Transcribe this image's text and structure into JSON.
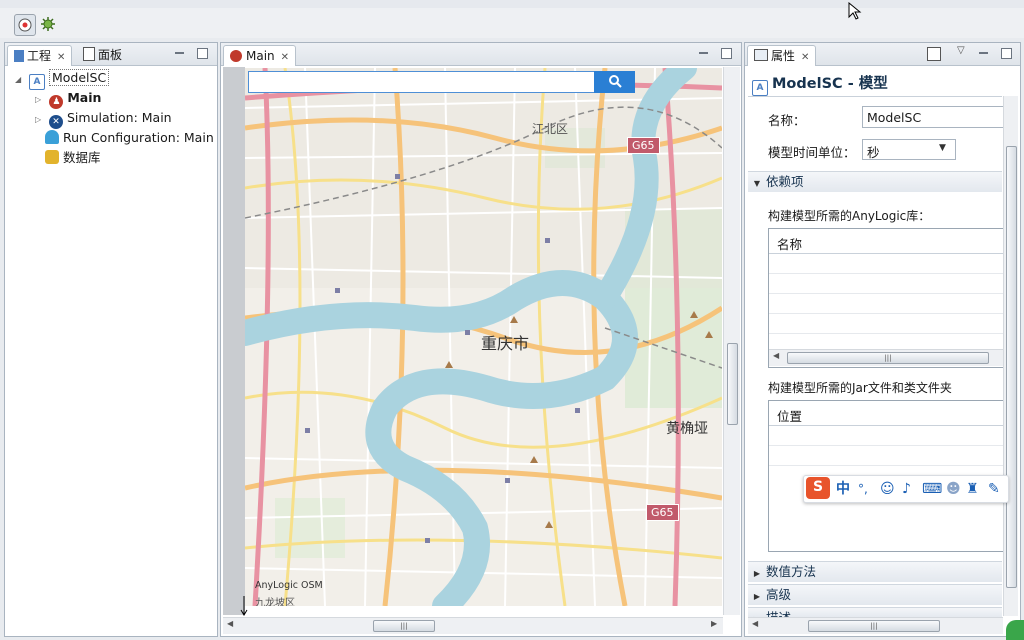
{
  "toolbar": {
    "icons": [
      "model-icon",
      "build-icon"
    ]
  },
  "left_panel": {
    "tabs": [
      {
        "label": "工程"
      },
      {
        "label": "面板"
      }
    ],
    "tree": [
      {
        "label": "ModelSC",
        "icon": "model-icon"
      },
      {
        "label": "Main",
        "icon": "agent-icon"
      },
      {
        "label": "Simulation: Main",
        "icon": "simulation-icon"
      },
      {
        "label": "Run Configuration: Main",
        "icon": "run-config-icon"
      },
      {
        "label": "数据库",
        "icon": "database-icon"
      }
    ]
  },
  "editor": {
    "tab_label": "Main",
    "map": {
      "search_placeholder": "",
      "labels": {
        "district_n": "江北区",
        "city": "重庆市",
        "area_e": "黄桷垭",
        "road_g65_top": "G65",
        "road_g65_bottom": "G65",
        "attribution": "AnyLogic OSM",
        "district_sw": "九龙坡区"
      }
    }
  },
  "properties": {
    "tab_label": "属性",
    "header": "ModelSC - 模型",
    "name_label": "名称：",
    "name_value": "ModelSC",
    "time_unit_label": "模型时间单位：",
    "time_unit_value": "秒",
    "section_dependencies": "依赖项",
    "libs_caption": "构建模型所需的AnyLogic库：",
    "libs_col": "名称",
    "jars_caption": "构建模型所需的Jar文件和类文件夹",
    "jars_col": "位置",
    "section_numeric": "数值方法",
    "section_advanced": "高级",
    "section_description": "描述"
  },
  "ime_toolbar": {
    "lang": "中",
    "punct": "°,"
  },
  "colors": {
    "accent": "#2a7fd4",
    "river": "#aad3df",
    "road_major": "#f6c37a",
    "road_motorway": "#e892a2"
  }
}
